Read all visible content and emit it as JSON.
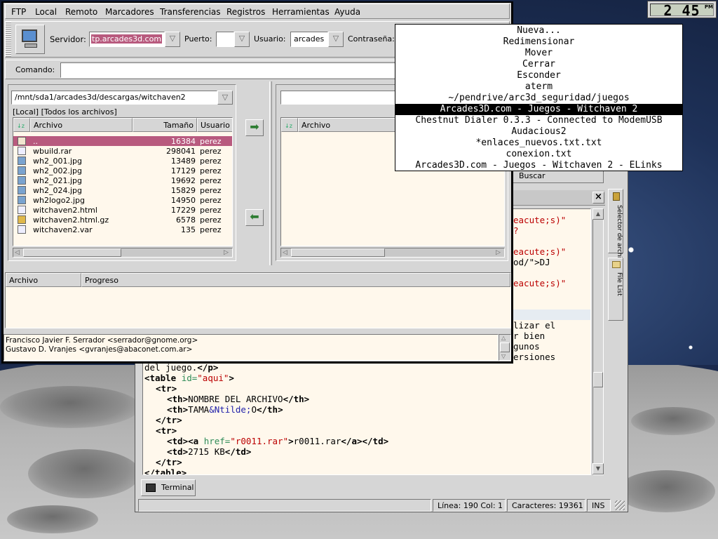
{
  "clock": {
    "time": "2 45",
    "ampm": "PM"
  },
  "ftp": {
    "menu": [
      "FTP",
      "Local",
      "Remoto",
      "Marcadores",
      "Transferencias",
      "Registros",
      "Herramientas",
      "Ayuda"
    ],
    "server_label": "Servidor:",
    "server_value": "tp.arcades3d.com",
    "port_label": "Puerto:",
    "port_value": "",
    "user_label": "Usuario:",
    "user_value": "arcades",
    "pass_label": "Contraseña:",
    "command_label": "Comando:",
    "local_path": "/mnt/sda1/arcades3d/descargas/witchaven2",
    "local_filter": "[Local] [Todos los archivos]",
    "cols": {
      "file": "Archivo",
      "size": "Tamaño",
      "user": "Usuario"
    },
    "remote_cols": {
      "file": "Archivo"
    },
    "files": [
      {
        "name": "..",
        "size": "16384",
        "user": "perez",
        "icon": "up-folder-icon"
      },
      {
        "name": "wbuild.rar",
        "size": "298041",
        "user": "perez",
        "icon": "file-icon"
      },
      {
        "name": "wh2_001.jpg",
        "size": "13489",
        "user": "perez",
        "icon": "image-icon"
      },
      {
        "name": "wh2_002.jpg",
        "size": "17129",
        "user": "perez",
        "icon": "image-icon"
      },
      {
        "name": "wh2_021.jpg",
        "size": "19692",
        "user": "perez",
        "icon": "image-icon"
      },
      {
        "name": "wh2_024.jpg",
        "size": "15829",
        "user": "perez",
        "icon": "image-icon"
      },
      {
        "name": "wh2logo2.jpg",
        "size": "14950",
        "user": "perez",
        "icon": "image-icon"
      },
      {
        "name": "witchaven2.html",
        "size": "17229",
        "user": "perez",
        "icon": "html-icon"
      },
      {
        "name": "witchaven2.html.gz",
        "size": "6578",
        "user": "perez",
        "icon": "archive-icon"
      },
      {
        "name": "witchaven2.var",
        "size": "135",
        "user": "perez",
        "icon": "file-icon"
      }
    ],
    "transfer_cols": {
      "file": "Archivo",
      "progress": "Progreso"
    },
    "log": [
      "Francisco Javier F. Serrador <serrador@gnome.org>",
      "Gustavo D. Vranjes <gvranjes@abaconet.com.ar>"
    ]
  },
  "menu_popup": {
    "items": [
      "Nueva...",
      "Redimensionar",
      "Mover",
      "Cerrar",
      "Esconder",
      "aterm",
      "~/pendrive/arc3d_seguridad/juegos",
      "Arcades3D.com - Juegos - Witchaven 2",
      "Chestnut Dialer 0.3.3 - Connected to ModemUSB",
      "Audacious2",
      "*enlaces_nuevos.txt.txt",
      "conexion.txt",
      "Arcades3D.com - Juegos - Witchaven 2 - ELinks"
    ],
    "selected_index": 7
  },
  "editor": {
    "search_label": "Buscar",
    "side_tabs": [
      "Selector de archivos",
      "File List"
    ],
    "frag": {
      "l1": "eacute;s)\"",
      "l2": "?",
      "l3": "eacute;s)\"",
      "l4": "od/\">DJ",
      "l5": "eacute;s)\"",
      "l6": "lizar el",
      "l7": "r bien",
      "l8": "gunos",
      "l9": "ersiones"
    },
    "code": {
      "l10a": "del juego.",
      "l10b": "</p>",
      "table_tag": "<table ",
      "table_attr": "id=",
      "table_val": "\"aqui\"",
      "table_end": ">",
      "tr": "<tr>",
      "th": "<th>",
      "th_end": "</th>",
      "th1_text": "NOMBRE DEL ARCHIVO",
      "th2_text": "TAMA",
      "th2_ent": "&Ntilde;",
      "th2_rest": "O",
      "tr_end": "</tr>",
      "td": "<td>",
      "td_end": "</td>",
      "a_open": "<a ",
      "a_attr": "href=",
      "a_val": "\"r0011.rar\"",
      "a_close": ">",
      "a_text": "r0011.rar",
      "a_end": "</a>",
      "td2_text": "2715 KB",
      "table_close": "</table>"
    },
    "terminal_tab": "Terminal",
    "status": {
      "line": "Línea: 190 Col: 1",
      "chars": "Caracteres: 19361",
      "mode": "INS"
    }
  }
}
